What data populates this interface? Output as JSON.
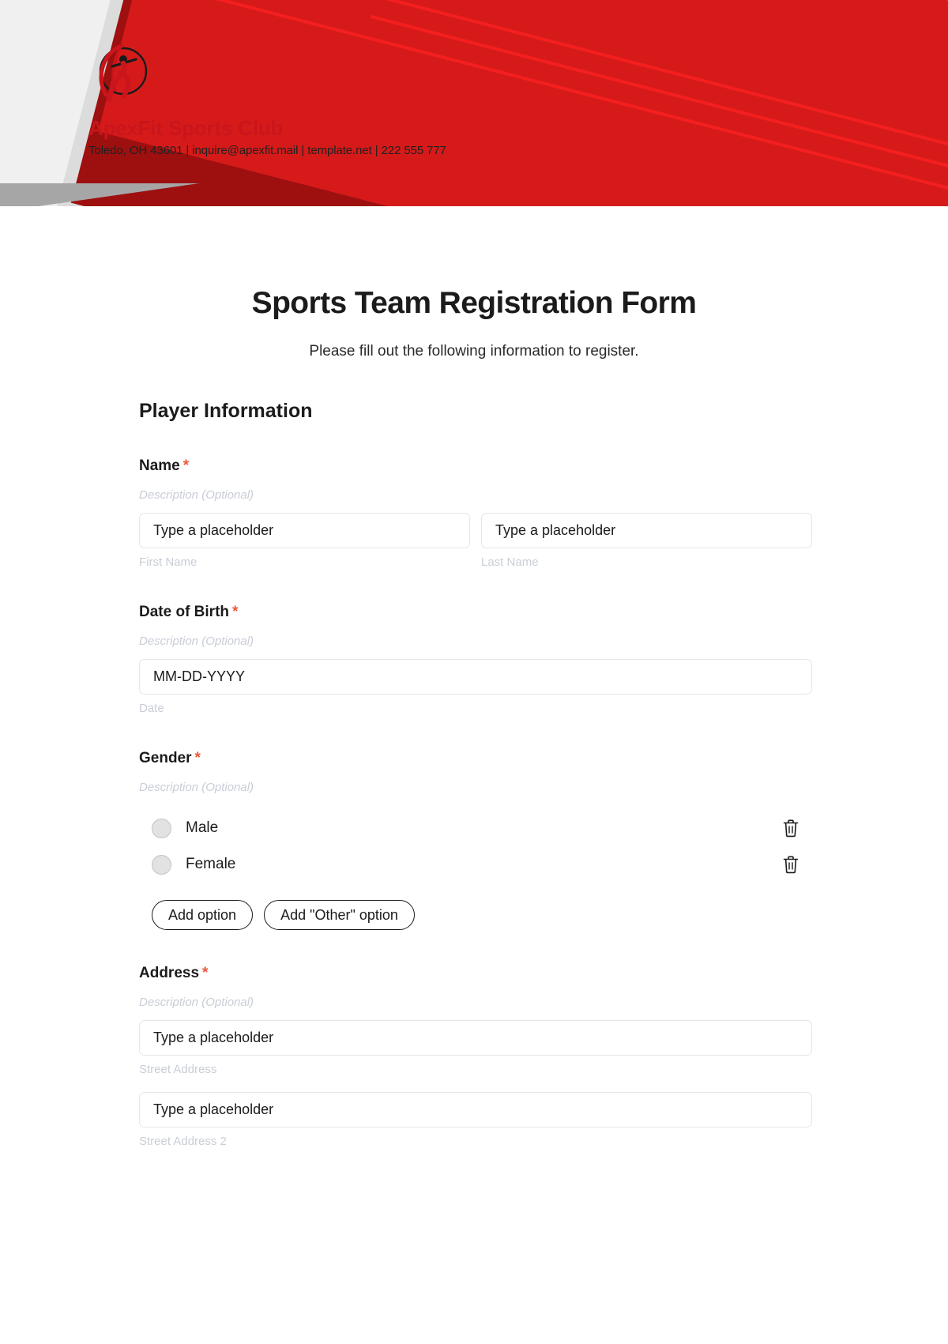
{
  "letterhead": {
    "brand_name": "ApexFit Sports Club",
    "contact_line": "Toledo, OH 43601 | inquire@apexfit.mail | template.net | 222 555 777",
    "logo_icon": "athlete-circle-logo",
    "colors": {
      "red": "#d61a1a",
      "dark_red": "#9e1010",
      "bright_red": "#f51f1f",
      "brand_text_red": "#c9151b",
      "light_grey": "#dcdcdc",
      "mid_grey": "#a6a6a6",
      "background": "#f0f0f0"
    }
  },
  "form": {
    "title": "Sports Team Registration Form",
    "subtitle": "Please fill out the following information to register.",
    "required_marker": "*",
    "sections": [
      {
        "heading": "Player Information",
        "fields": [
          {
            "label": "Name",
            "required": true,
            "description": "Description (Optional)",
            "type": "name",
            "inputs": [
              {
                "placeholder": "Type a placeholder",
                "sublabel": "First Name"
              },
              {
                "placeholder": "Type a placeholder",
                "sublabel": "Last Name"
              }
            ]
          },
          {
            "label": "Date of Birth",
            "required": true,
            "description": "Description (Optional)",
            "type": "date",
            "inputs": [
              {
                "placeholder": "MM-DD-YYYY",
                "sublabel": "Date"
              }
            ]
          },
          {
            "label": "Gender",
            "required": true,
            "description": "Description (Optional)",
            "type": "radio",
            "options": [
              {
                "label": "Male",
                "delete_icon": "trash-icon"
              },
              {
                "label": "Female",
                "delete_icon": "trash-icon"
              }
            ],
            "buttons": [
              {
                "label": "Add option"
              },
              {
                "label": "Add \"Other\" option"
              }
            ]
          },
          {
            "label": "Address",
            "required": true,
            "description": "Description (Optional)",
            "type": "address",
            "inputs": [
              {
                "placeholder": "Type a placeholder",
                "sublabel": "Street Address"
              },
              {
                "placeholder": "Type a placeholder",
                "sublabel": "Street Address 2"
              }
            ]
          }
        ]
      }
    ]
  }
}
